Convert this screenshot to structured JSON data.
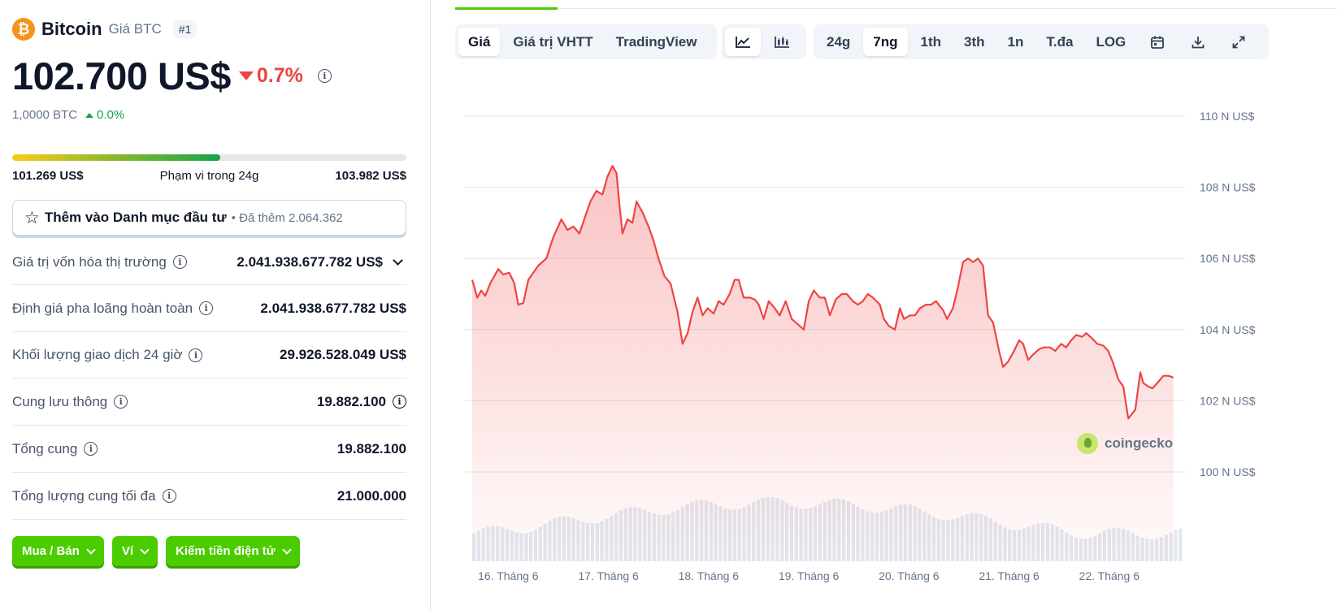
{
  "coin": {
    "name": "Bitcoin",
    "symbol_label": "Giá BTC",
    "rank": "#1",
    "logo_glyph": "₿",
    "price": "102.700 US$",
    "change": "0.7%",
    "btc_value": "1,0000 BTC",
    "btc_change": "0.0%"
  },
  "range": {
    "low": "101.269 US$",
    "label": "Phạm vi trong 24g",
    "high": "103.982 US$",
    "fill_percent": 52.7
  },
  "watchlist": {
    "label": "Thêm vào Danh mục đầu tư",
    "sub": "• Đã thêm 2.064.362"
  },
  "stats": [
    {
      "label": "Giá trị vốn hóa thị trường",
      "value": "2.041.938.677.782 US$"
    },
    {
      "label": "Định giá pha loãng hoàn toàn",
      "value": "2.041.938.677.782 US$"
    },
    {
      "label": "Khối lượng giao dịch 24 giờ",
      "value": "29.926.528.049 US$"
    },
    {
      "label": "Cung lưu thông",
      "value": "19.882.100"
    },
    {
      "label": "Tổng cung",
      "value": "19.882.100"
    },
    {
      "label": "Tổng lượng cung tối đa",
      "value": "21.000.000"
    }
  ],
  "actions": [
    "Mua / Bán",
    "Ví",
    "Kiếm tiền điện tử"
  ],
  "tabs": {
    "view": [
      "Giá",
      "Giá trị VHTT",
      "TradingView"
    ],
    "ranges": [
      "24g",
      "7ng",
      "1th",
      "3th",
      "1n",
      "T.đa",
      "LOG"
    ],
    "active_view": "Giá",
    "active_range": "7ng"
  },
  "icons": {
    "line_chart": "line-chart-icon",
    "candle_chart": "candlestick-icon",
    "calendar": "calendar-icon",
    "download": "download-icon",
    "expand": "expand-icon"
  },
  "watermark": "coingecko",
  "colors": {
    "brand_green": "#4bcc00",
    "down_red": "#ef4444",
    "up_green": "#16a34a",
    "btc_orange": "#f7931a"
  },
  "chart_data": {
    "type": "area",
    "ylim": [
      100,
      110
    ],
    "y_ticks": [
      {
        "value": 110,
        "label": "110 N US$"
      },
      {
        "value": 108,
        "label": "108 N US$"
      },
      {
        "value": 106,
        "label": "106 N US$"
      },
      {
        "value": 104,
        "label": "104 N US$"
      },
      {
        "value": 102,
        "label": "102 N US$"
      },
      {
        "value": 100,
        "label": "100 N US$"
      }
    ],
    "x_ticks": [
      "16. Tháng 6",
      "17. Tháng 6",
      "18. Tháng 6",
      "19. Tháng 6",
      "20. Tháng 6",
      "21. Tháng 6",
      "22. Tháng 6"
    ],
    "x_range_days": [
      0,
      7.1
    ],
    "x_tick_days": [
      0.36,
      1.36,
      2.36,
      3.36,
      4.36,
      5.36,
      6.36
    ],
    "series": [
      {
        "points": [
          [
            0.0,
            105.4
          ],
          [
            0.05,
            104.9
          ],
          [
            0.09,
            105.1
          ],
          [
            0.13,
            104.95
          ],
          [
            0.18,
            105.3
          ],
          [
            0.26,
            105.7
          ],
          [
            0.31,
            105.55
          ],
          [
            0.37,
            105.6
          ],
          [
            0.42,
            105.3
          ],
          [
            0.46,
            104.7
          ],
          [
            0.51,
            104.75
          ],
          [
            0.56,
            105.4
          ],
          [
            0.61,
            105.6
          ],
          [
            0.66,
            105.8
          ],
          [
            0.74,
            106.0
          ],
          [
            0.81,
            106.6
          ],
          [
            0.89,
            107.1
          ],
          [
            0.95,
            106.8
          ],
          [
            1.01,
            106.9
          ],
          [
            1.07,
            106.7
          ],
          [
            1.13,
            107.2
          ],
          [
            1.18,
            107.6
          ],
          [
            1.24,
            107.9
          ],
          [
            1.3,
            107.8
          ],
          [
            1.35,
            108.3
          ],
          [
            1.4,
            108.6
          ],
          [
            1.44,
            108.4
          ],
          [
            1.47,
            107.5
          ],
          [
            1.5,
            106.7
          ],
          [
            1.55,
            107.1
          ],
          [
            1.6,
            107.0
          ],
          [
            1.64,
            107.6
          ],
          [
            1.7,
            107.3
          ],
          [
            1.76,
            106.9
          ],
          [
            1.81,
            106.5
          ],
          [
            1.86,
            106.0
          ],
          [
            1.92,
            105.5
          ],
          [
            1.98,
            105.3
          ],
          [
            2.05,
            104.5
          ],
          [
            2.1,
            103.6
          ],
          [
            2.15,
            103.9
          ],
          [
            2.2,
            104.5
          ],
          [
            2.25,
            104.9
          ],
          [
            2.3,
            104.4
          ],
          [
            2.35,
            104.6
          ],
          [
            2.41,
            104.45
          ],
          [
            2.46,
            104.8
          ],
          [
            2.51,
            104.7
          ],
          [
            2.57,
            105.0
          ],
          [
            2.62,
            105.4
          ],
          [
            2.66,
            105.4
          ],
          [
            2.71,
            104.9
          ],
          [
            2.77,
            104.9
          ],
          [
            2.82,
            104.85
          ],
          [
            2.86,
            104.7
          ],
          [
            2.91,
            104.3
          ],
          [
            2.96,
            104.8
          ],
          [
            3.02,
            104.6
          ],
          [
            3.07,
            104.4
          ],
          [
            3.13,
            104.8
          ],
          [
            3.19,
            104.3
          ],
          [
            3.25,
            104.15
          ],
          [
            3.31,
            104.0
          ],
          [
            3.36,
            104.8
          ],
          [
            3.41,
            105.1
          ],
          [
            3.47,
            104.9
          ],
          [
            3.52,
            104.9
          ],
          [
            3.57,
            104.4
          ],
          [
            3.63,
            104.85
          ],
          [
            3.69,
            105.0
          ],
          [
            3.74,
            105.0
          ],
          [
            3.8,
            104.8
          ],
          [
            3.85,
            104.7
          ],
          [
            3.9,
            104.8
          ],
          [
            3.95,
            105.0
          ],
          [
            4.0,
            104.9
          ],
          [
            4.07,
            104.7
          ],
          [
            4.11,
            104.3
          ],
          [
            4.16,
            104.1
          ],
          [
            4.22,
            104.0
          ],
          [
            4.27,
            104.6
          ],
          [
            4.31,
            104.3
          ],
          [
            4.37,
            104.4
          ],
          [
            4.42,
            104.4
          ],
          [
            4.47,
            104.6
          ],
          [
            4.53,
            104.7
          ],
          [
            4.58,
            104.7
          ],
          [
            4.63,
            104.8
          ],
          [
            4.7,
            104.55
          ],
          [
            4.74,
            104.3
          ],
          [
            4.8,
            104.6
          ],
          [
            4.85,
            105.2
          ],
          [
            4.9,
            105.9
          ],
          [
            4.95,
            106.0
          ],
          [
            5.0,
            105.9
          ],
          [
            5.05,
            106.0
          ],
          [
            5.1,
            105.8
          ],
          [
            5.15,
            104.4
          ],
          [
            5.2,
            104.2
          ],
          [
            5.26,
            103.4
          ],
          [
            5.3,
            102.95
          ],
          [
            5.35,
            103.1
          ],
          [
            5.41,
            103.4
          ],
          [
            5.46,
            103.7
          ],
          [
            5.5,
            103.6
          ],
          [
            5.55,
            103.15
          ],
          [
            5.6,
            103.3
          ],
          [
            5.66,
            103.45
          ],
          [
            5.71,
            103.5
          ],
          [
            5.77,
            103.5
          ],
          [
            5.82,
            103.4
          ],
          [
            5.88,
            103.6
          ],
          [
            5.93,
            103.5
          ],
          [
            5.98,
            103.7
          ],
          [
            6.03,
            103.85
          ],
          [
            6.09,
            103.8
          ],
          [
            6.13,
            103.9
          ],
          [
            6.19,
            103.75
          ],
          [
            6.24,
            103.6
          ],
          [
            6.3,
            103.55
          ],
          [
            6.35,
            103.4
          ],
          [
            6.4,
            103.05
          ],
          [
            6.45,
            102.6
          ],
          [
            6.5,
            102.4
          ],
          [
            6.55,
            101.5
          ],
          [
            6.62,
            101.75
          ],
          [
            6.67,
            102.8
          ],
          [
            6.7,
            102.5
          ],
          [
            6.75,
            102.4
          ],
          [
            6.79,
            102.35
          ],
          [
            6.84,
            102.5
          ],
          [
            6.9,
            102.7
          ],
          [
            6.95,
            102.7
          ],
          [
            7.0,
            102.65
          ]
        ]
      }
    ]
  }
}
